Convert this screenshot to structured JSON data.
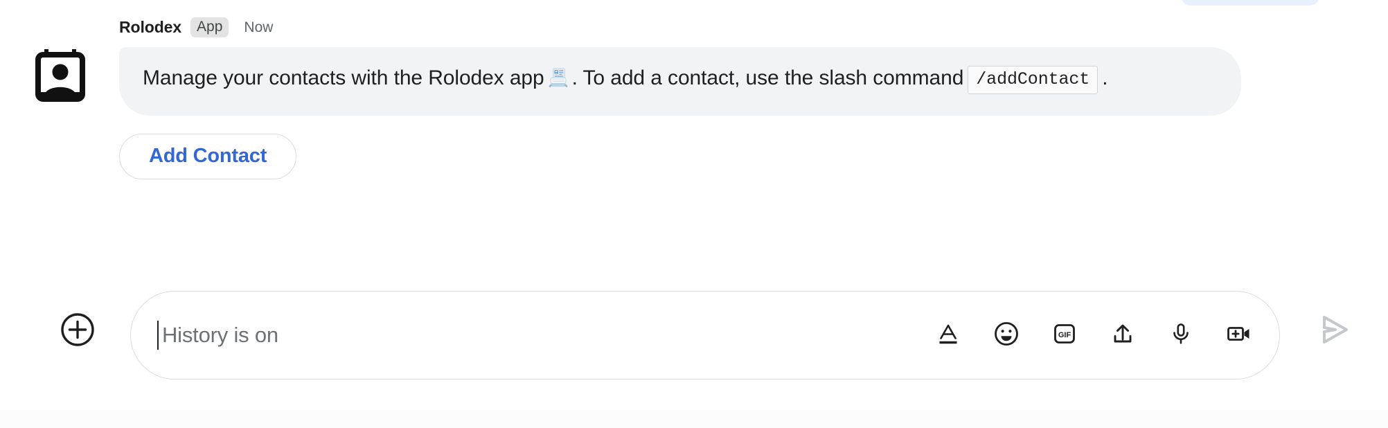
{
  "message": {
    "avatar_icon": "contact-card-person-icon",
    "sender": "Rolodex",
    "badge": "App",
    "timestamp": "Now",
    "body_part1": "Manage your contacts with the Rolodex app",
    "body_emoji": "card-index-emoji",
    "body_part2": ". To add a contact, use the slash command",
    "code_chip": "/addContact",
    "body_part3": ".",
    "action_button": "Add Contact",
    "action_button_color": "#3367d6"
  },
  "composer": {
    "add_label": "plus-icon",
    "placeholder": "History is on",
    "value": "",
    "tools": [
      {
        "name": "format-text-icon",
        "label": "A"
      },
      {
        "name": "emoji-icon",
        "label": "Emoji"
      },
      {
        "name": "gif-icon",
        "label": "GIF"
      },
      {
        "name": "upload-icon",
        "label": "Upload"
      },
      {
        "name": "microphone-icon",
        "label": "Voice"
      },
      {
        "name": "add-video-icon",
        "label": "Video"
      }
    ],
    "send_label": "Send",
    "send_color": "#c4c7cb"
  },
  "theme": {
    "background": "#ffffff",
    "bubble_bg": "#f1f3f4",
    "badge_bg": "#e3e3e3",
    "text": "#1f1f1f",
    "muted_text": "#5f6368",
    "border": "#dadce0"
  }
}
